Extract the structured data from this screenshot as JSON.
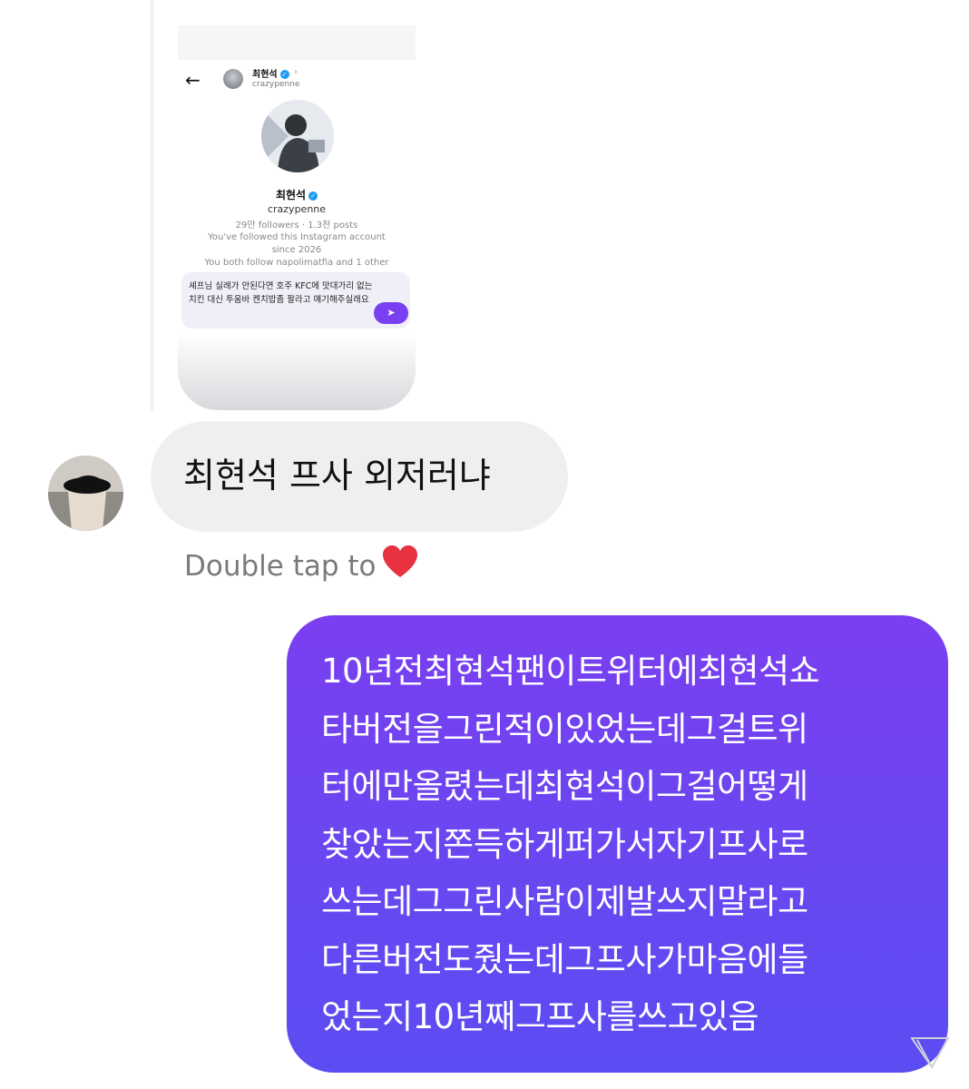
{
  "shared_post": {
    "profile_name": "최현석",
    "handle": "crazypenne",
    "stats": "29만 followers · 1.3천 posts",
    "followed_since": "You've followed this Instagram account since 2026",
    "mutual": "You both follow napolimatfia and 1 other",
    "compose_text": "셰프님 실례가 안된다면 호주 KFC에 맛대가리 없는 치킨 대신 투움바 켄치밥좀 팔라고 얘기해주실래요"
  },
  "received_message": {
    "text": "최현석 프사 외저러냐",
    "double_tap_hint": "Double tap to"
  },
  "sent_message": {
    "lines": [
      "10년전최현석팬이트위터에최현석쇼",
      "타버전을그린적이있었는데그걸트위",
      "터에만올렸는데최현석이그걸어떻게",
      "찾았는지쫀득하게퍼가서자기프사로",
      "쓰는데그그린사람이제발쓰지말라고",
      "다른버전도줬는데그프사가마음에들",
      "었는지10년째그프사를쓰고있음"
    ]
  },
  "colors": {
    "sent_gradient_top": "#7a3ff0",
    "sent_gradient_bottom": "#5b4df2",
    "received_bubble": "#efefef",
    "verified": "#1d9bf0",
    "heart": "#e8323f"
  },
  "icons": [
    "back-arrow-icon",
    "verified-icon",
    "chevron-right-icon",
    "send-icon",
    "heart-icon",
    "seen-icon"
  ]
}
